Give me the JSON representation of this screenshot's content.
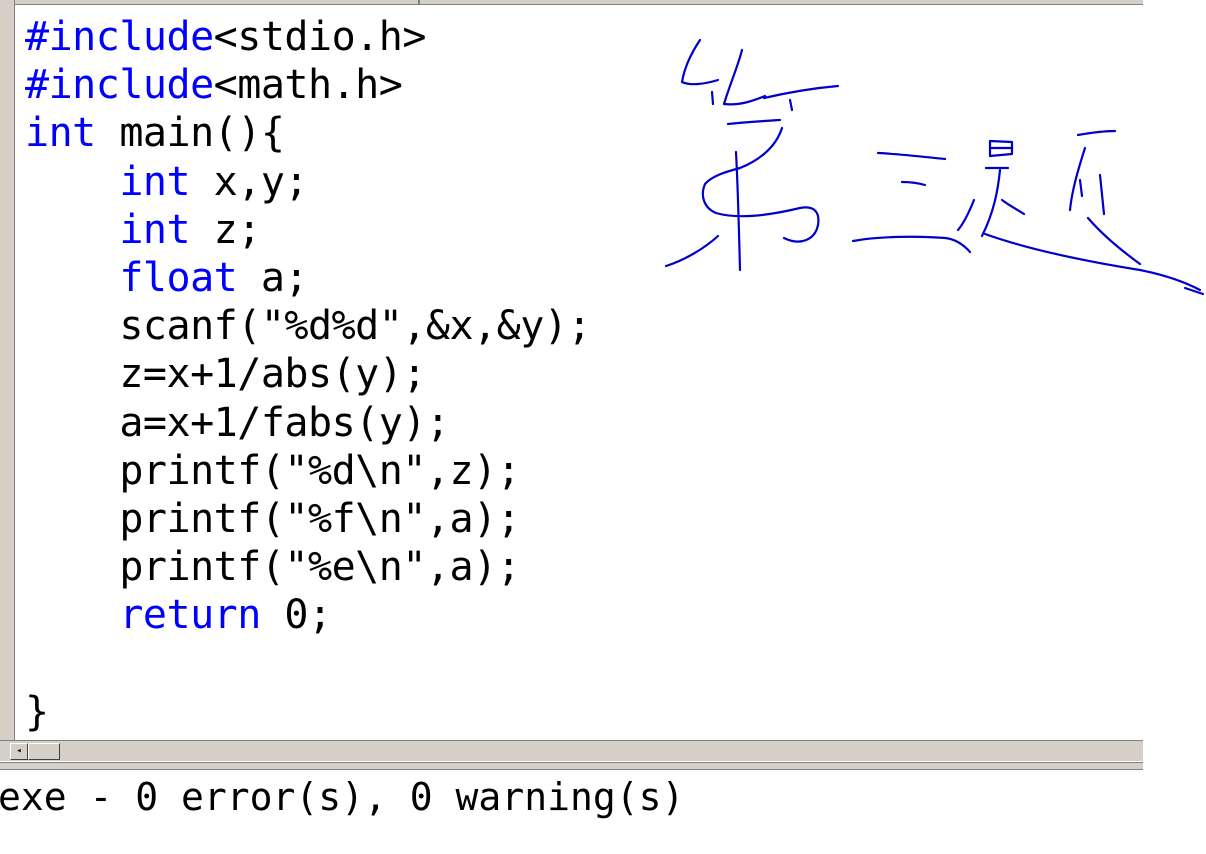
{
  "editor": {
    "lines": [
      [
        {
          "t": "#include",
          "kw": true
        },
        {
          "t": "<stdio.h>",
          "kw": false
        }
      ],
      [
        {
          "t": "#include",
          "kw": true
        },
        {
          "t": "<math.h>",
          "kw": false
        }
      ],
      [
        {
          "t": "int",
          "kw": true
        },
        {
          "t": " main(){",
          "kw": false
        }
      ],
      [
        {
          "t": "    ",
          "kw": false
        },
        {
          "t": "int",
          "kw": true
        },
        {
          "t": " x,y;",
          "kw": false
        }
      ],
      [
        {
          "t": "    ",
          "kw": false
        },
        {
          "t": "int",
          "kw": true
        },
        {
          "t": " z;",
          "kw": false
        }
      ],
      [
        {
          "t": "    ",
          "kw": false
        },
        {
          "t": "float",
          "kw": true
        },
        {
          "t": " a;",
          "kw": false
        }
      ],
      [
        {
          "t": "    scanf(\"%d%d\",&x,&y);",
          "kw": false
        }
      ],
      [
        {
          "t": "    z=x+1/abs(y);",
          "kw": false
        }
      ],
      [
        {
          "t": "    a=x+1/fabs(y);",
          "kw": false
        }
      ],
      [
        {
          "t": "    printf(\"%d\\n\",z);",
          "kw": false
        }
      ],
      [
        {
          "t": "    printf(\"%f\\n\",a);",
          "kw": false
        }
      ],
      [
        {
          "t": "    printf(\"%e\\n\",a);",
          "kw": false
        }
      ],
      [
        {
          "t": "    ",
          "kw": false
        },
        {
          "t": "return",
          "kw": true
        },
        {
          "t": " 0;",
          "kw": false
        }
      ],
      [
        {
          "t": "",
          "kw": false
        }
      ],
      [
        {
          "t": "}",
          "kw": false
        }
      ]
    ],
    "keyword_color": "#0000ff",
    "text_color": "#000000"
  },
  "scrollbar": {
    "left_arrow": "◂"
  },
  "output": {
    "build_status": "exe - 0 error(s), 0 warning(s)"
  },
  "annotation": {
    "type": "handwritten-ink",
    "color": "#0000cc",
    "text": "第三题"
  }
}
